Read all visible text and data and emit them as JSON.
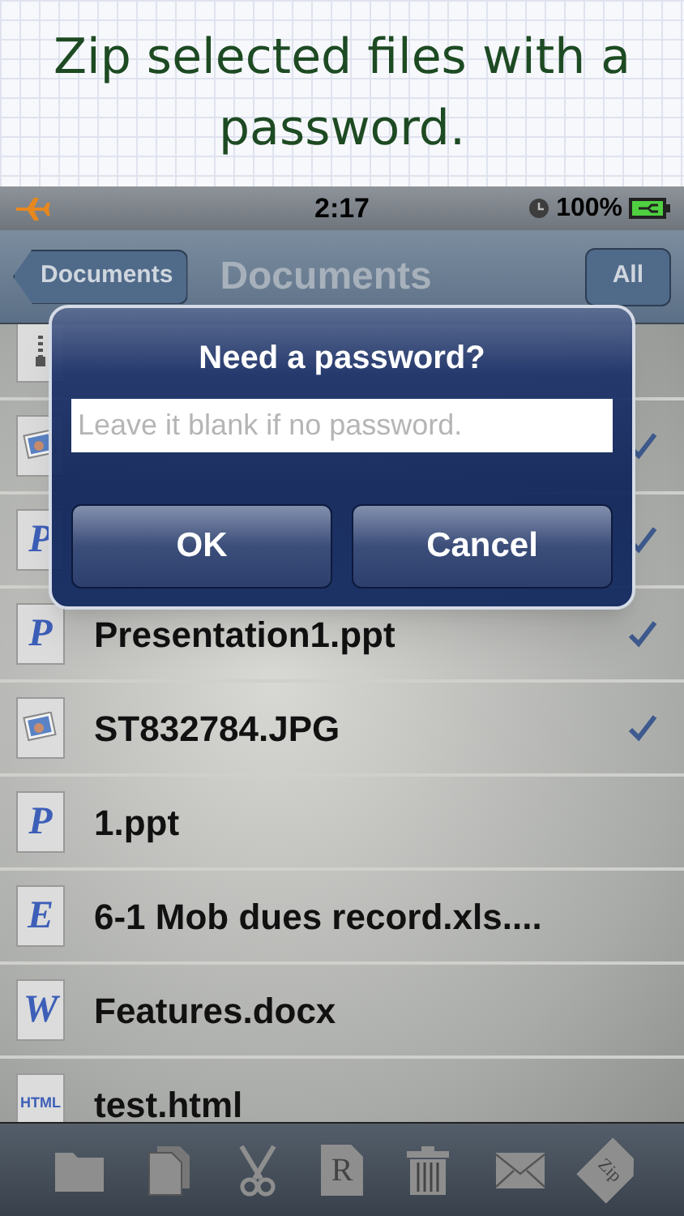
{
  "caption": {
    "lines": [
      "Zip selected files with a",
      "password."
    ]
  },
  "status_bar": {
    "time": "2:17",
    "battery": "100%"
  },
  "nav_bar": {
    "back": "Documents",
    "title": "Documents",
    "action": "All"
  },
  "files": [
    {
      "kind": "zip",
      "checked": false
    },
    {
      "kind": "image",
      "checked": true
    },
    {
      "kind": "letter",
      "letter": "P",
      "checked": true
    },
    {
      "kind": "letter",
      "letter": "P",
      "name": "Presentation1.ppt",
      "checked": true
    },
    {
      "kind": "image",
      "name": "ST832784.JPG",
      "checked": true
    },
    {
      "kind": "letter",
      "letter": "P",
      "name": "1.ppt",
      "checked": false
    },
    {
      "kind": "letter",
      "letter": "E",
      "name": "6-1 Mob dues record.xls....",
      "checked": false
    },
    {
      "kind": "letter",
      "letter": "W",
      "name": "Features.docx",
      "checked": false
    },
    {
      "kind": "html",
      "letter": "HTML",
      "name": "test.html",
      "checked": false
    }
  ],
  "dialog": {
    "title": "Need a password?",
    "placeholder": "Leave it blank if no password.",
    "buttons": [
      "OK",
      "Cancel"
    ]
  },
  "toolbar": [
    {
      "kind": "folder"
    },
    {
      "kind": "copy"
    },
    {
      "kind": "scissors"
    },
    {
      "kind": "doc",
      "letter": "R"
    },
    {
      "kind": "trash"
    },
    {
      "kind": "mail"
    },
    {
      "kind": "doc",
      "letter": "Zip"
    }
  ]
}
